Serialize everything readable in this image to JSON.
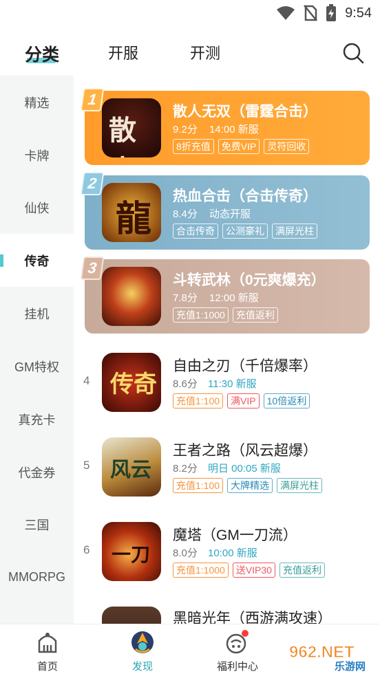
{
  "status": {
    "time": "9:54"
  },
  "tabs": [
    {
      "label": "分类",
      "active": true
    },
    {
      "label": "开服",
      "active": false
    },
    {
      "label": "开测",
      "active": false
    }
  ],
  "sidebar": {
    "items": [
      {
        "label": "精选"
      },
      {
        "label": "卡牌"
      },
      {
        "label": "仙侠"
      },
      {
        "label": "传奇",
        "active": true
      },
      {
        "label": "挂机"
      },
      {
        "label": "GM特权"
      },
      {
        "label": "真充卡"
      },
      {
        "label": "代金券"
      },
      {
        "label": "三国"
      },
      {
        "label": "MMORPG"
      }
    ]
  },
  "games": [
    {
      "rank": "1",
      "name": "散人无双（雷霆合击）",
      "score": "9.2分",
      "time": "14:00 新服",
      "icon_text": "散人",
      "tags": [
        "8折充值",
        "免费VIP",
        "灵符回收"
      ]
    },
    {
      "rank": "2",
      "name": "热血合击（合击传奇）",
      "score": "8.4分",
      "time": "动态开服",
      "icon_text": "龍",
      "tags": [
        "合击传奇",
        "公测豪礼",
        "满屏光柱"
      ]
    },
    {
      "rank": "3",
      "name": "斗转武林（0元爽爆充）",
      "score": "7.8分",
      "time": "12:00 新服",
      "icon_text": "",
      "tags": [
        "充值1:1000",
        "充值返利"
      ]
    },
    {
      "rank": "4",
      "name": "自由之刃（千倍爆率）",
      "score": "8.6分",
      "time": "11:30 新服",
      "icon_text": "传奇",
      "tags": [
        "充值1:100",
        "满VIP",
        "10倍返利"
      ]
    },
    {
      "rank": "5",
      "name": "王者之路（风云超爆）",
      "score": "8.2分",
      "time": "明日 00:05 新服",
      "icon_text": "风云",
      "tags": [
        "充值1:100",
        "大牌精选",
        "满屏光柱"
      ]
    },
    {
      "rank": "6",
      "name": "魔塔（GM一刀流）",
      "score": "8.0分",
      "time": "10:00 新服",
      "icon_text": "一刀",
      "tags": [
        "充值1:1000",
        "送VIP30",
        "充值返利"
      ]
    },
    {
      "rank": "",
      "name": "黑暗光年（西游满攻速）",
      "score": "",
      "time": "",
      "icon_text": "",
      "tags": []
    }
  ],
  "bottom_nav": [
    {
      "label": "首页",
      "icon": "home-icon"
    },
    {
      "label": "发现",
      "icon": "discover-icon",
      "active": true
    },
    {
      "label": "福利中心",
      "icon": "gift-icon"
    }
  ],
  "watermark": {
    "text": "962.NET",
    "sub": "乐游网"
  },
  "colors": {
    "accent": "#56c8d0",
    "active_nav": "#2aa6b2",
    "card1": "#ff9b2a",
    "card2": "#7fb0c9",
    "card3": "#c8aa9a"
  }
}
